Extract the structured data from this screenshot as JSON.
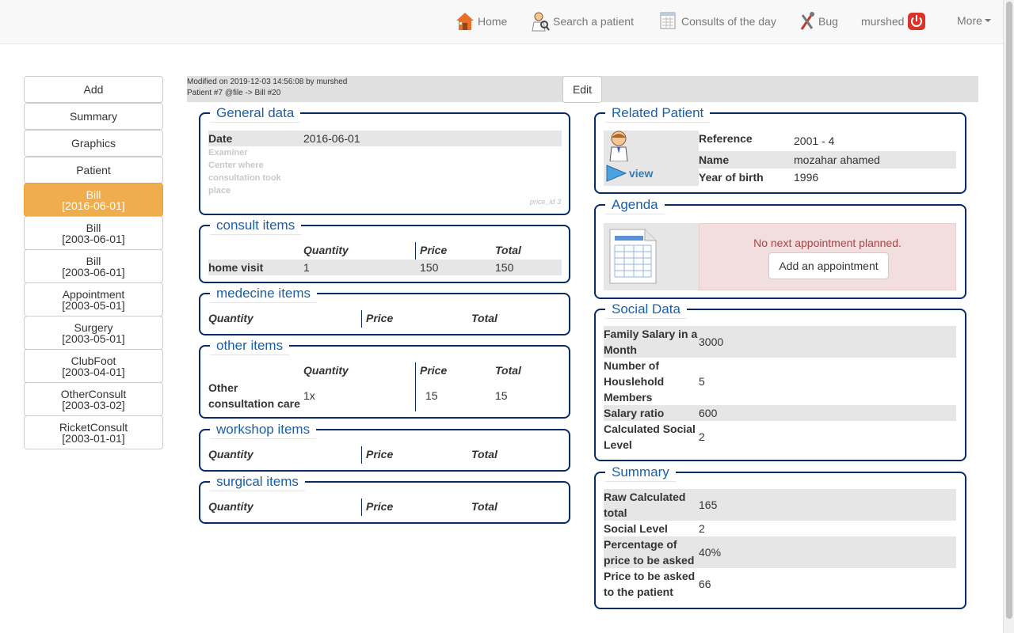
{
  "nav": {
    "home": "Home",
    "search": "Search a patient",
    "consults": "Consults of the day",
    "bug": "Bug",
    "user": "murshed",
    "more": "More"
  },
  "sidebar": [
    {
      "label": "Add",
      "date": ""
    },
    {
      "label": "Summary",
      "date": ""
    },
    {
      "label": "Graphics",
      "date": ""
    },
    {
      "label": "Patient",
      "date": ""
    },
    {
      "label": "Bill",
      "date": "[2016-06-01]"
    },
    {
      "label": "Bill",
      "date": "[2003-06-01]"
    },
    {
      "label": "Bill",
      "date": "[2003-06-01]"
    },
    {
      "label": "Appointment",
      "date": "[2003-05-01]"
    },
    {
      "label": "Surgery",
      "date": "[2003-05-01]"
    },
    {
      "label": "ClubFoot",
      "date": "[2003-04-01]"
    },
    {
      "label": "OtherConsult",
      "date": "[2003-03-02]"
    },
    {
      "label": "RicketConsult",
      "date": "[2003-01-01]"
    }
  ],
  "header": {
    "modified": "Modified on 2019-12-03 14:56:08 by murshed",
    "patient_ref": "Patient #7 @file -> Bill #20",
    "edit": "Edit"
  },
  "general": {
    "title": "General data",
    "date_label": "Date",
    "date_value": "2016-06-01",
    "examiner_label": "Examiner",
    "center_label": "Center where consultation took place",
    "price_id": "price_id 3"
  },
  "consult": {
    "title": "consult items",
    "col_qty": "Quantity",
    "col_price": "Price",
    "col_total": "Total",
    "row_name": "home visit",
    "row_qty": "1",
    "row_price": "150",
    "row_total": "150"
  },
  "medecine": {
    "title": "medecine items",
    "col_qty": "Quantity",
    "col_price": "Price",
    "col_total": "Total"
  },
  "other": {
    "title": "other items",
    "col_qty": "Quantity",
    "col_price": "Price",
    "col_total": "Total",
    "row_name": "Other consultation care",
    "row_qty": "1x",
    "row_price": "15",
    "row_total": "15"
  },
  "workshop": {
    "title": "workshop items",
    "col_qty": "Quantity",
    "col_price": "Price",
    "col_total": "Total"
  },
  "surgical": {
    "title": "surgical items",
    "col_qty": "Quantity",
    "col_price": "Price",
    "col_total": "Total"
  },
  "related": {
    "title": "Related Patient",
    "view": "view",
    "reference_label": "Reference",
    "reference_value": "2001 - 4",
    "name_label": "Name",
    "name_value": "mozahar ahamed",
    "yob_label": "Year of birth",
    "yob_value": "1996"
  },
  "agenda": {
    "title": "Agenda",
    "message": "No next appointment planned.",
    "add_button": "Add an appointment"
  },
  "social": {
    "title": "Social Data",
    "family_salary_label": "Family Salary in a Month",
    "family_salary_value": "3000",
    "household_label": "Number of Houslehold Members",
    "household_value": "5",
    "ratio_label": "Salary ratio",
    "ratio_value": "600",
    "level_label": "Calculated Social Level",
    "level_value": "2"
  },
  "summary": {
    "title": "Summary",
    "raw_label": "Raw Calculated total",
    "raw_value": "165",
    "social_label": "Social Level",
    "social_value": "2",
    "pct_label": "Percentage of price to be asked",
    "pct_value": "40%",
    "price_label": "Price to be asked to the patient",
    "price_value": "66"
  }
}
